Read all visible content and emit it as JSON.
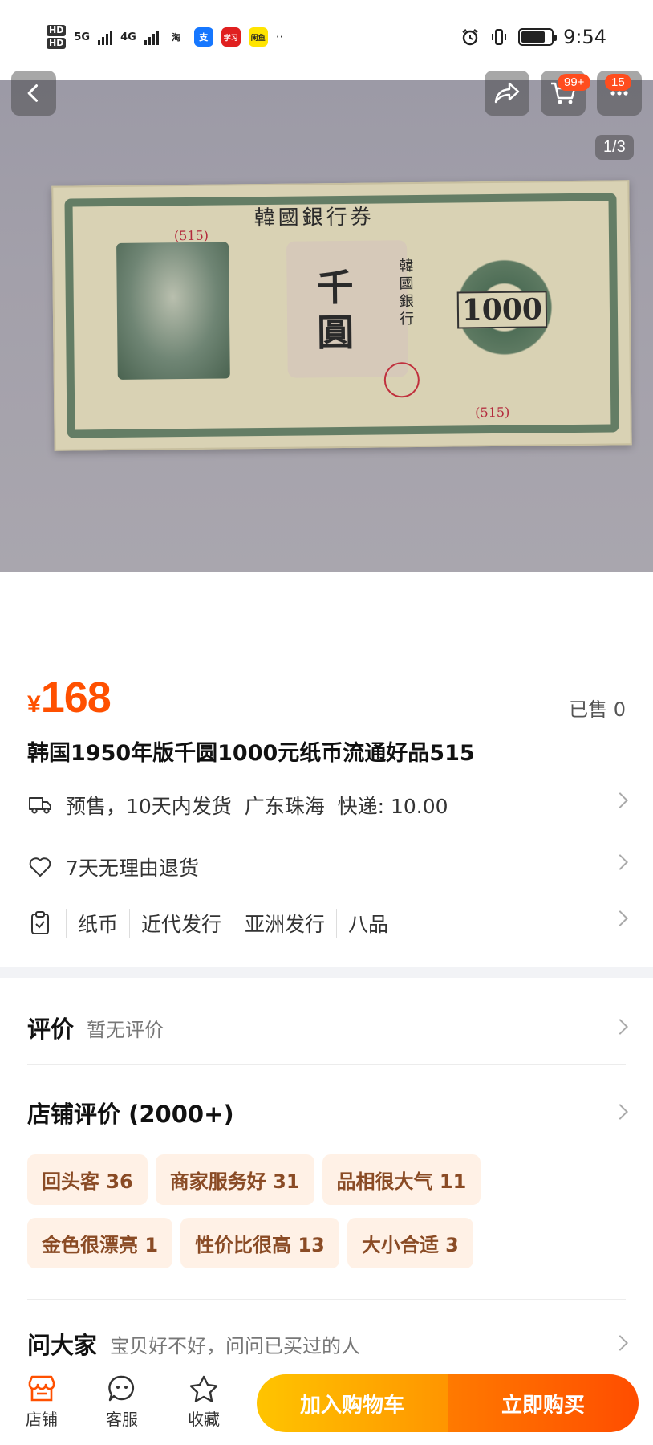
{
  "status_bar": {
    "hd1": "HD",
    "hd2": "HD",
    "net1": "5G",
    "net2": "4G",
    "apps": [
      {
        "name": "taobao-icon",
        "label": "淘",
        "color": "#ffffff",
        "text_color": "#222222"
      },
      {
        "name": "alipay-icon",
        "label": "支",
        "color": "#1677ff",
        "text_color": "#ffffff"
      },
      {
        "name": "xuexi-icon",
        "label": "学习",
        "color": "#e02020",
        "text_color": "#ffffff"
      },
      {
        "name": "xianyu-icon",
        "label": "闲鱼",
        "color": "#ffe400",
        "text_color": "#222222"
      }
    ],
    "more": "··",
    "time": "9:54",
    "battery_level": 0.8
  },
  "gallery": {
    "counter": "1/3",
    "cart_badge": "99+",
    "msg_badge": "15",
    "banknote": {
      "top_text": "韓國銀行券",
      "big_text": "千圓",
      "side_text": "韓國銀行",
      "denomination": "1000",
      "serial": "(515)"
    }
  },
  "product": {
    "currency": "¥",
    "price": "168",
    "sold": "已售 0",
    "title": "韩国1950年版千圆1000元纸币流通好品515",
    "shipping": "预售，10天内发货  广东珠海  快递: 10.00",
    "return_policy": "7天无理由退货",
    "attributes": [
      "纸币",
      "近代发行",
      "亚洲发行",
      "八品"
    ]
  },
  "reviews": {
    "heading": "评价",
    "empty_text": "暂无评价"
  },
  "shop_reviews": {
    "heading": "店铺评价 (2000+)",
    "tags": [
      "回头客 36",
      "商家服务好 31",
      "品相很大气 11",
      "金色很漂亮 1",
      "性价比很高 13",
      "大小合适 3"
    ]
  },
  "ask": {
    "heading": "问大家",
    "prompt": "宝贝好不好，问问已买过的人"
  },
  "bottom_bar": {
    "shop": "店铺",
    "service": "客服",
    "favorite": "收藏",
    "add_to_cart": "加入购物车",
    "buy_now": "立即购买",
    "accent": "#ff5000"
  }
}
